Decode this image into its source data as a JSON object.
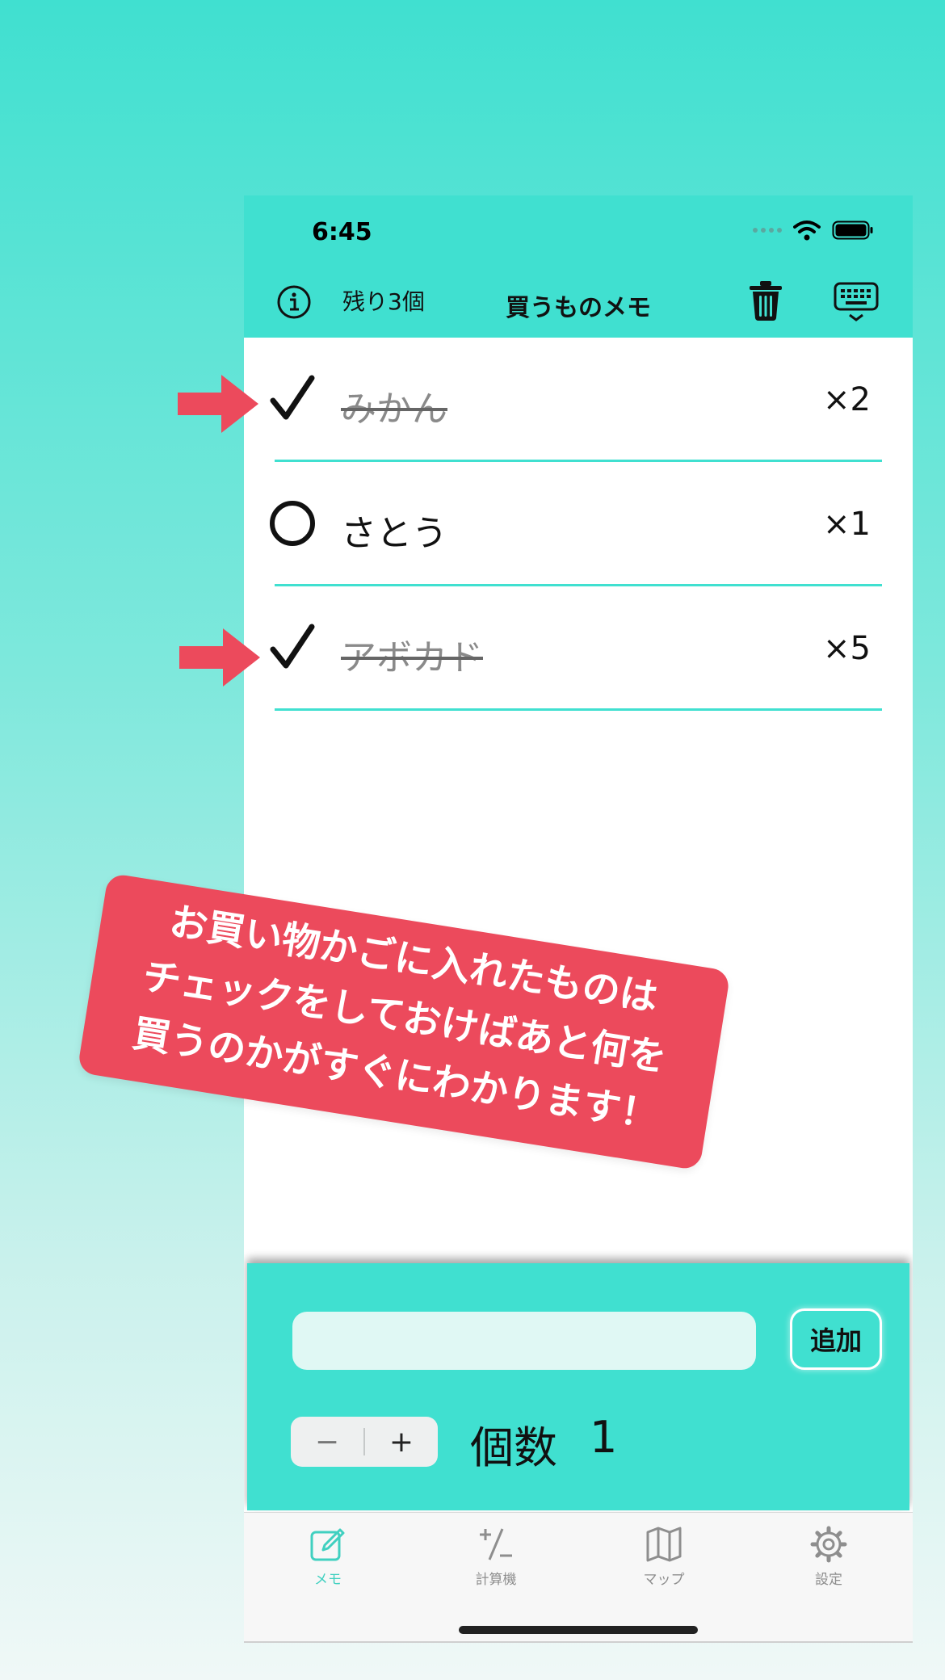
{
  "status_bar": {
    "time": "6:45"
  },
  "nav": {
    "remaining": "残り3個",
    "title": "買うものメモ"
  },
  "items": [
    {
      "name": "みかん",
      "qty": "×2",
      "checked": true
    },
    {
      "name": "さとう",
      "qty": "×1",
      "checked": false
    },
    {
      "name": "アボカド",
      "qty": "×5",
      "checked": true
    }
  ],
  "input_panel": {
    "input_value": "",
    "add_label": "追加",
    "minus_label": "−",
    "plus_label": "+",
    "count_label": "個数",
    "count_value": "1"
  },
  "tabs": [
    {
      "label": "メモ",
      "icon": "memo-icon",
      "active": true
    },
    {
      "label": "計算機",
      "icon": "calculator-icon",
      "active": false
    },
    {
      "label": "マップ",
      "icon": "map-icon",
      "active": false
    },
    {
      "label": "設定",
      "icon": "gear-icon",
      "active": false
    }
  ],
  "banner": {
    "lines": [
      "お買い物かごに入れたものは",
      "チェックをしておけばあと何を",
      "買うのかがすぐにわかります！"
    ]
  },
  "colors": {
    "accent": "#40e0d0",
    "banner": "#ec4a5c",
    "arrow": "#ec4a5c",
    "checked_text": "#8a8a8a"
  }
}
